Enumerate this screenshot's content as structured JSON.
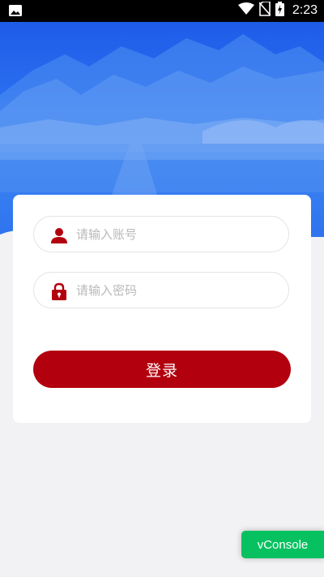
{
  "status_bar": {
    "time": "2:23",
    "icons": [
      "image-icon",
      "wifi-icon",
      "no-sim-icon",
      "battery-charging-icon"
    ]
  },
  "login": {
    "username_placeholder": "请输入账号",
    "username_icon": "user-icon",
    "password_placeholder": "请输入密码",
    "password_icon": "lock-icon",
    "submit_label": "登录"
  },
  "vconsole": {
    "label": "vConsole"
  },
  "colors": {
    "accent": "#b3000e",
    "hero_blue": "#2b6ef0",
    "vconsole_green": "#07c160",
    "page_bg": "#f2f2f4"
  }
}
